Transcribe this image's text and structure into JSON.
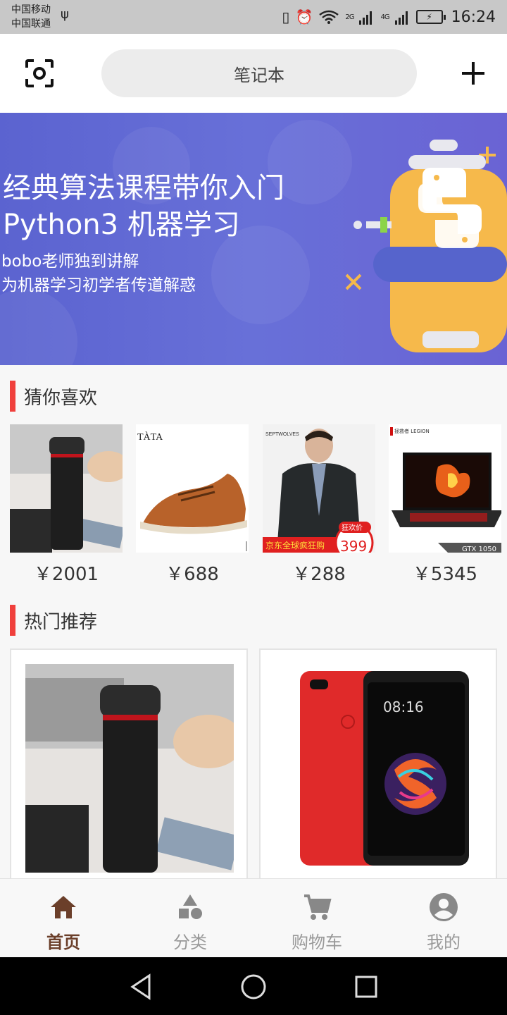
{
  "status_bar": {
    "carrier1": "中国移动",
    "carrier2": "中国联通",
    "net1": "2G",
    "net2": "4G",
    "time": "16:24"
  },
  "header": {
    "search_text": "笔记本",
    "scan_icon": "scan-icon",
    "add_icon": "plus-icon"
  },
  "banner": {
    "line1": "经典算法课程带你入门",
    "line2": "Python3 机器学习",
    "line3": "bobo老师独到讲解",
    "line4": "为机器学习初学者传道解惑"
  },
  "guess_section": {
    "title": "猜你喜欢",
    "items": [
      {
        "price": "￥2001",
        "image": "black-thermos-bottle"
      },
      {
        "price": "￥688",
        "image": "brown-leather-shoe",
        "brand": "TÀTA"
      },
      {
        "price": "￥288",
        "image": "man-in-down-jacket",
        "brand": "SEPTWOLVES",
        "promo_tag": "狂欢价",
        "promo_price": "399",
        "promo_banner": "京东全球疯狂购"
      },
      {
        "price": "￥5345",
        "image": "gaming-laptop",
        "brand": "拯救者 LEGION",
        "badge": "GTX 1050"
      }
    ]
  },
  "hot_section": {
    "title": "热门推荐",
    "items": [
      {
        "image": "black-thermos-bottle"
      },
      {
        "image": "red-smartphone",
        "screen_time": "08:16"
      }
    ]
  },
  "tabbar": {
    "tabs": [
      {
        "label": "首页",
        "icon": "home-icon",
        "active": true
      },
      {
        "label": "分类",
        "icon": "category-icon",
        "active": false
      },
      {
        "label": "购物车",
        "icon": "cart-icon",
        "active": false
      },
      {
        "label": "我的",
        "icon": "user-icon",
        "active": false
      }
    ]
  },
  "colors": {
    "accent_bar": "#f0403c",
    "active_tab": "#6b3f2a",
    "banner_bg": "#5b63d0"
  }
}
